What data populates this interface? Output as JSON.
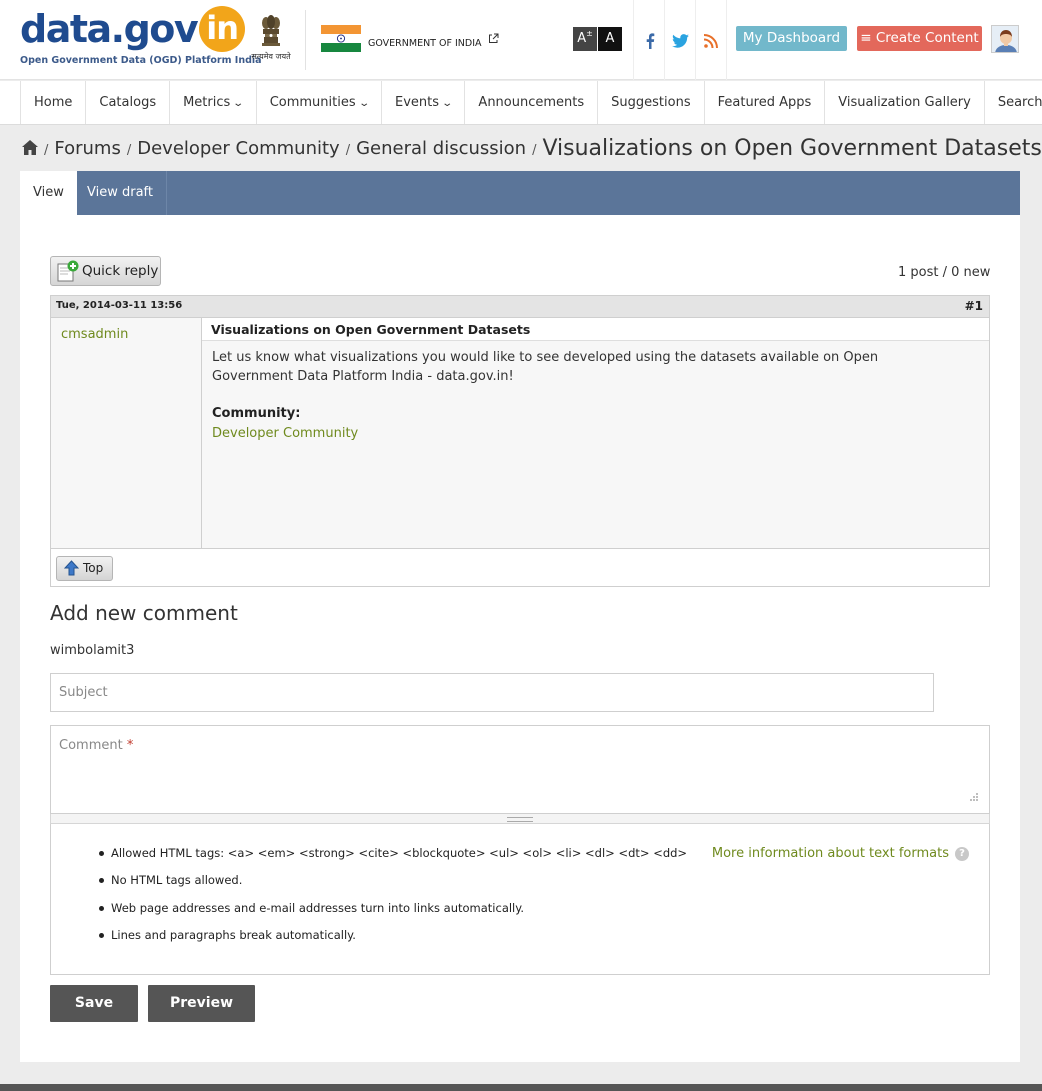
{
  "header": {
    "logo_text": "data.gov",
    "logo_in": "in",
    "logo_subtitle": "Open Government Data (OGD) Platform India",
    "emblem_caption": "सत्यमेव जयते",
    "gov_label": "GOVERNMENT OF INDIA",
    "font_increase": "A",
    "font_contrast": "A",
    "dashboard_label": "My Dashboard",
    "create_label": "≡ Create Content",
    "colors": {
      "brand_blue": "#1f4b8f",
      "brand_orange": "#f2a51a",
      "dashboard": "#72b8cb",
      "create": "#e3685b"
    }
  },
  "nav": {
    "items": [
      {
        "label": "Home"
      },
      {
        "label": "Catalogs"
      },
      {
        "label": "Metrics"
      },
      {
        "label": "Communities"
      },
      {
        "label": "Events"
      },
      {
        "label": "Announcements"
      },
      {
        "label": "Suggestions"
      },
      {
        "label": "Featured Apps"
      },
      {
        "label": "Visualization Gallery"
      },
      {
        "label": "Search"
      }
    ]
  },
  "breadcrumb": {
    "items": [
      "Forums",
      "Developer Community",
      "General discussion"
    ],
    "separator": "/",
    "current": "Visualizations on Open Government Datasets"
  },
  "tabs": [
    {
      "label": "View"
    },
    {
      "label": "View draft"
    }
  ],
  "forum": {
    "quick_reply": "Quick reply",
    "post_count": "1 post / 0 new",
    "post": {
      "date": "Tue, 2014-03-11 13:56",
      "number": "#1",
      "author": "cmsadmin",
      "title": "Visualizations on Open Government Datasets",
      "text": "Let us know what visualizations you would like to see developed using the datasets available on Open Government Data Platform India - data.gov.in!",
      "community_label": "Community:",
      "community_link": "Developer Community",
      "top_label": "Top"
    }
  },
  "comment_form": {
    "heading": "Add new comment",
    "username": "wimbolamit3",
    "subject_placeholder": "Subject",
    "comment_label": "Comment",
    "required_mark": "*",
    "tips": [
      "Allowed HTML tags: <a> <em> <strong> <cite> <blockquote> <ul> <ol> <li> <dl> <dt> <dd>",
      "No HTML tags allowed.",
      "Web page addresses and e-mail addresses turn into links automatically.",
      "Lines and paragraphs break automatically."
    ],
    "more_info": "More information about text formats",
    "help_icon": "?",
    "save_label": "Save",
    "preview_label": "Preview"
  }
}
